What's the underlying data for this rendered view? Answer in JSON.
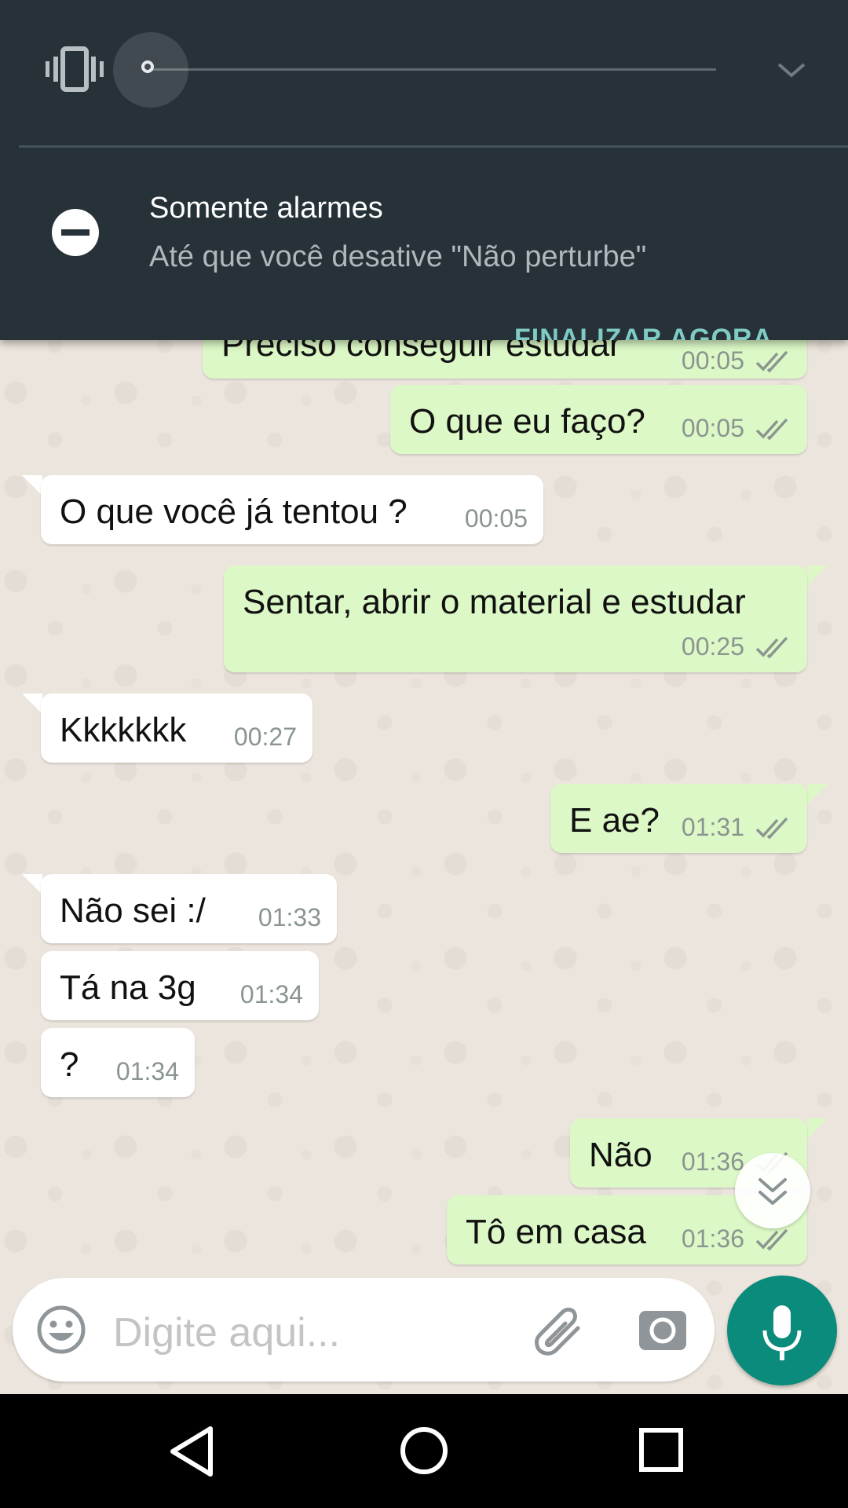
{
  "notification_shade": {
    "dnd_title": "Somente alarmes",
    "dnd_subtitle": "Até que você desative \"Não perturbe\"",
    "dnd_action": "FINALIZAR AGORA",
    "volume_icon": "vibrate-icon",
    "expand_icon": "chevron-down-icon",
    "dnd_icon": "minus-circle-icon"
  },
  "messages": [
    {
      "text": "Preciso conseguir estudar",
      "time": "00:05",
      "direction": "out",
      "status": "read"
    },
    {
      "text": "O que eu faço?",
      "time": "00:05",
      "direction": "out",
      "status": "read"
    },
    {
      "text": "O que você já tentou ?",
      "time": "00:05",
      "direction": "in"
    },
    {
      "text": "Sentar, abrir o material e estudar",
      "time": "00:25",
      "direction": "out",
      "status": "read"
    },
    {
      "text": "Kkkkkkk",
      "time": "00:27",
      "direction": "in"
    },
    {
      "text": "E ae?",
      "time": "01:31",
      "direction": "out",
      "status": "read"
    },
    {
      "text": "Não sei :/",
      "time": "01:33",
      "direction": "in"
    },
    {
      "text": "Tá na 3g",
      "time": "01:34",
      "direction": "in"
    },
    {
      "text": "?",
      "time": "01:34",
      "direction": "in"
    },
    {
      "text": "Não",
      "time": "01:36",
      "direction": "out",
      "status": "read"
    },
    {
      "text": "Tô em casa",
      "time": "01:36",
      "direction": "out",
      "status": "read"
    }
  ],
  "composer": {
    "placeholder": "Digite aqui...",
    "emoji_icon": "emoji-icon",
    "attach_icon": "paperclip-icon",
    "camera_icon": "camera-icon",
    "mic_icon": "microphone-icon",
    "scroll_icon": "double-chevron-down-icon"
  },
  "navigation": {
    "back": "back-triangle-icon",
    "home": "home-circle-icon",
    "recents": "recents-square-icon"
  },
  "colors": {
    "shade_bg": "#263238",
    "accent": "#80cbc4",
    "outgoing_bubble": "#dcf8c6",
    "incoming_bubble": "#ffffff",
    "mic_button": "#0b8b7b",
    "read_ticks": "#8b9590"
  }
}
